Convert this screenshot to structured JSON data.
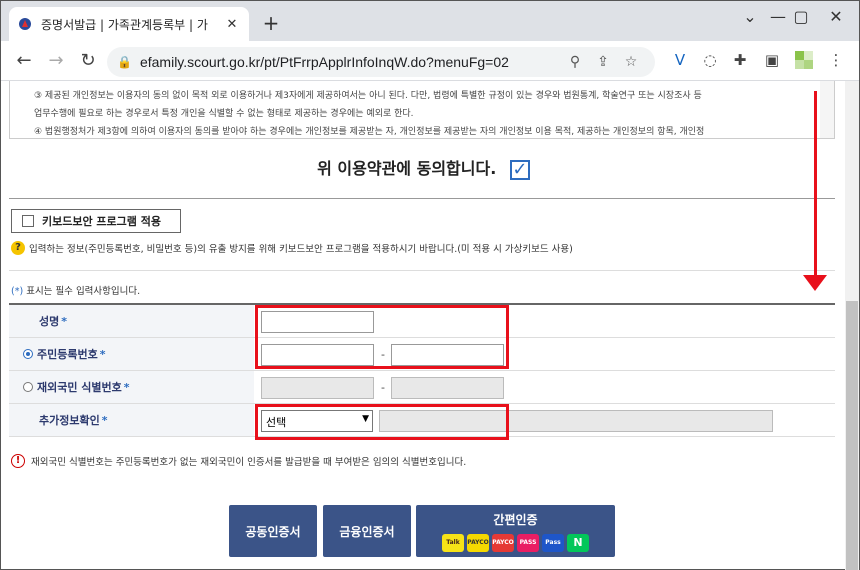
{
  "browser": {
    "tab_title": "증명서발급 | 가족관계등록부 | 가",
    "url": "efamily.scourt.go.kr/pt/PtFrrpApplrInfoInqW.do?menuFg=02"
  },
  "terms": {
    "lines": [
      "③ 제공된 개인정보는 이용자의 동의 없이 목적 외로 이용하거나 제3자에게 제공하여서는 아니 된다. 다만, 법령에 특별한 규정이 있는 경우와 법원통계, 학술연구 또는 시장조사 등",
      "업무수행에 필요로 하는 경우로서 특정 개인을 식별할 수 없는 형태로 제공하는 경우에는 예외로 한다.",
      "④ 법원행정처가 제3항에 의하여 이용자의 동의를 받아야 하는 경우에는 개인정보를 제공받는 자, 개인정보를 제공받는 자의 개인정보 이용 목적, 제공하는 개인정보의 항목, 개인정"
    ],
    "agree_label": "위 이용약관에 동의합니다."
  },
  "keyboard_security": {
    "label": "키보드보안 프로그램 적용",
    "info": "입력하는 정보(주민등록번호, 비밀번호 등)의 유출 방지를 위해 키보드보안 프로그램을 적용하시기 바랍니다.(미 적용 시 가상키보드 사용)"
  },
  "required_note": {
    "star": "(*)",
    "text": "표시는 필수 입력사항입니다."
  },
  "form": {
    "star": "*",
    "name_label": "성명",
    "rrn_label": "주민등록번호",
    "foreign_label": "재외국민 식별번호",
    "extra_label": "추가정보확인",
    "dash": "-",
    "select_value": "선택"
  },
  "warning": "재외국민 식별번호는 주민등록번호가 없는 재외국민이 인증서를 발급받을 때 부여받은 임의의 식별번호입니다.",
  "buttons": {
    "joint_cert": "공동인증서",
    "finance_cert": "금융인증서",
    "easy_auth": "간편인증",
    "logos": [
      "Talk",
      "PAYCO",
      "PAYCO",
      "PASS",
      "Pass",
      "N"
    ]
  },
  "colors": {
    "accent": "#2d6cbf",
    "button": "#3b5488",
    "annotation_red": "#e8101b"
  }
}
